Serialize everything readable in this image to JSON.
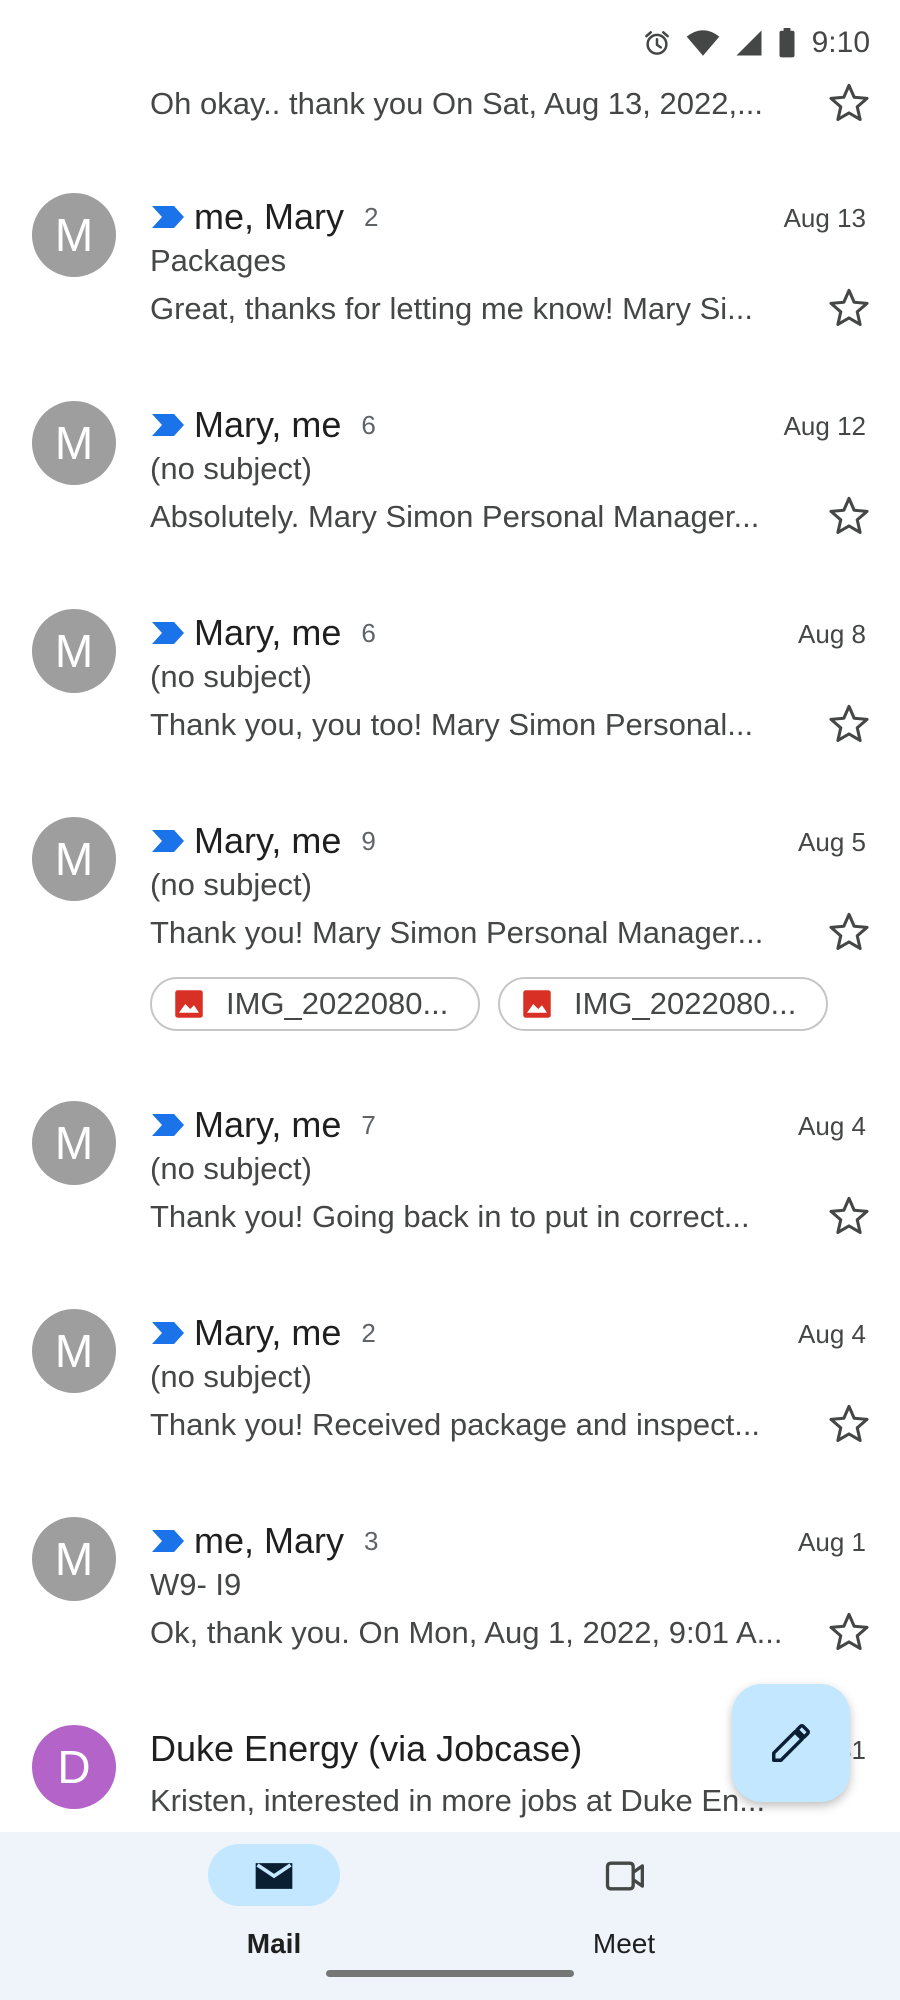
{
  "status_bar": {
    "time": "9:10",
    "icons": [
      "alarm-icon",
      "wifi-icon",
      "signal-icon",
      "battery-icon"
    ]
  },
  "top_partial": {
    "snippet": "Oh okay.. thank you On Sat, Aug 13, 2022,..."
  },
  "emails": [
    {
      "avatar": "M",
      "sender": "me, Mary",
      "count": "2",
      "date": "Aug 13",
      "subject": "Packages",
      "snippet": "Great, thanks for letting me know! Mary Si..."
    },
    {
      "avatar": "M",
      "sender": "Mary, me",
      "count": "6",
      "date": "Aug 12",
      "subject": "(no subject)",
      "snippet": "Absolutely. Mary Simon Personal Manager..."
    },
    {
      "avatar": "M",
      "sender": "Mary, me",
      "count": "6",
      "date": "Aug 8",
      "subject": "(no subject)",
      "snippet": "Thank you, you too! Mary Simon Personal..."
    },
    {
      "avatar": "M",
      "sender": "Mary, me",
      "count": "9",
      "date": "Aug 5",
      "subject": "(no subject)",
      "snippet": "Thank you! Mary Simon Personal Manager...",
      "attachments": [
        "IMG_2022080...",
        "IMG_2022080..."
      ]
    },
    {
      "avatar": "M",
      "sender": "Mary, me",
      "count": "7",
      "date": "Aug 4",
      "subject": "(no subject)",
      "snippet": "Thank you! Going back in to put in correct..."
    },
    {
      "avatar": "M",
      "sender": "Mary, me",
      "count": "2",
      "date": "Aug 4",
      "subject": "(no subject)",
      "snippet": "Thank you! Received package and inspect..."
    },
    {
      "avatar": "M",
      "sender": "me, Mary",
      "count": "3",
      "date": "Aug 1",
      "subject": "W9- I9",
      "snippet": "Ok, thank you. On Mon, Aug 1, 2022, 9:01 A..."
    }
  ],
  "last_email": {
    "avatar": "D",
    "sender": "Duke Energy (via Jobcase)",
    "date_partial": "31",
    "snippet": "Kristen, interested in more jobs at Duke En..."
  },
  "compose": {
    "icon": "pencil-icon"
  },
  "bottom_nav": {
    "mail_label": "Mail",
    "meet_label": "Meet"
  },
  "colors": {
    "accent": "#1a73e8",
    "fab_background": "#c2e7ff",
    "nav_background": "#eff3fa",
    "avatar_gray": "#9e9e9e",
    "avatar_purple": "#b464c9",
    "attachment_red": "#d93025"
  }
}
